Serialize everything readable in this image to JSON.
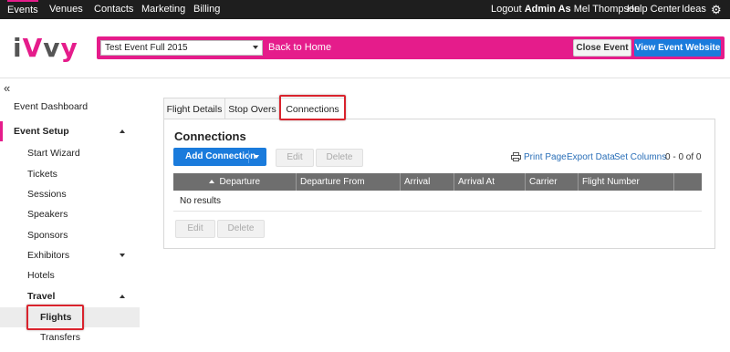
{
  "topnav": {
    "left": [
      "Events",
      "Venues",
      "Contacts",
      "Marketing",
      "Billing"
    ],
    "logout_prefix": "Logout",
    "user_bold": "Admin As",
    "user_name": "Mel Thompson",
    "help": "Help Center",
    "ideas": "Ideas",
    "gear_icon": "gear-icon"
  },
  "header": {
    "logo": "iVvy",
    "event_select": "Test Event Full 2015",
    "back_home": "Back to Home",
    "close_event": "Close Event",
    "view_site": "View Event Website"
  },
  "sidebar": {
    "collapse_glyph": "«",
    "items": [
      {
        "label": "Event Dashboard"
      },
      {
        "label": "Event Setup"
      },
      {
        "label": "Start Wizard"
      },
      {
        "label": "Tickets"
      },
      {
        "label": "Sessions"
      },
      {
        "label": "Speakers"
      },
      {
        "label": "Sponsors"
      },
      {
        "label": "Exhibitors"
      },
      {
        "label": "Hotels"
      },
      {
        "label": "Travel"
      },
      {
        "label": "Flights"
      },
      {
        "label": "Transfers"
      }
    ]
  },
  "tabs": [
    "Flight Details",
    "Stop Overs",
    "Connections"
  ],
  "section": {
    "title": "Connections",
    "add_button": "Add Connection",
    "edit": "Edit",
    "delete": "Delete",
    "print": "Print Page",
    "export": "Export Data",
    "columns": "Set Columns",
    "count": "0 - 0 of 0"
  },
  "table": {
    "columns": [
      "Departure",
      "Departure From",
      "Arrival",
      "Arrival At",
      "Carrier",
      "Flight Number"
    ],
    "empty": "No results"
  },
  "colors": {
    "accent": "#e51c8b",
    "primary_button": "#1a7bdc",
    "highlight_box": "#d9232d",
    "nav_bg": "#1e1e1e"
  }
}
